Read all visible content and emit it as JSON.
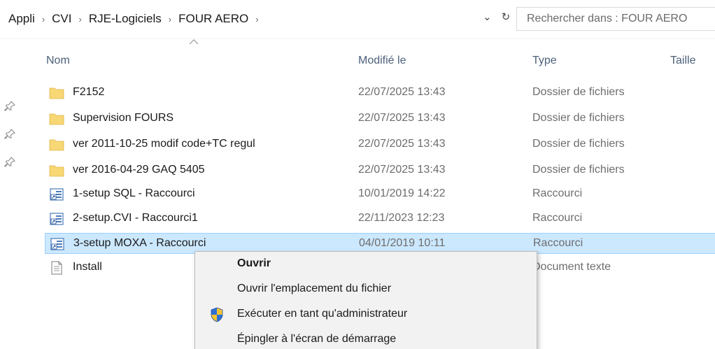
{
  "breadcrumb": [
    "Appli",
    "CVI",
    "RJE-Logiciels",
    "FOUR AERO"
  ],
  "breadcrumb_separator": "›",
  "address_controls": {
    "dropdown": "⌄",
    "refresh": "↻"
  },
  "search": {
    "placeholder": "Rechercher dans : FOUR AERO"
  },
  "columns": {
    "name": "Nom",
    "modified": "Modifié le",
    "type": "Type",
    "size": "Taille"
  },
  "files": [
    {
      "name": "F2152",
      "modified": "22/07/2025 13:43",
      "type": "Dossier de fichiers",
      "icon": "folder-icon"
    },
    {
      "name": "Supervision FOURS",
      "modified": "22/07/2025 13:43",
      "type": "Dossier de fichiers",
      "icon": "folder-icon"
    },
    {
      "name": "ver 2011-10-25 modif code+TC regul",
      "modified": "22/07/2025 13:43",
      "type": "Dossier de fichiers",
      "icon": "folder-icon"
    },
    {
      "name": "ver 2016-04-29 GAQ 5405",
      "modified": "22/07/2025 13:43",
      "type": "Dossier de fichiers",
      "icon": "folder-icon"
    },
    {
      "name": "1-setup SQL - Raccourci",
      "modified": "10/01/2019 14:22",
      "type": "Raccourci",
      "icon": "shortcut-icon"
    },
    {
      "name": "2-setup.CVI - Raccourci1",
      "modified": "22/11/2023 12:23",
      "type": "Raccourci",
      "icon": "shortcut-icon"
    },
    {
      "name": "3-setup MOXA - Raccourci",
      "modified": "04/01/2019 10:11",
      "type": "Raccourci",
      "icon": "shortcut-icon",
      "selected": true
    },
    {
      "name": "Install",
      "modified": "",
      "type": "Document texte",
      "icon": "text-document-icon"
    }
  ],
  "context_menu": [
    {
      "label": "Ouvrir",
      "bold": true
    },
    {
      "label": "Ouvrir l'emplacement du fichier"
    },
    {
      "label": "Exécuter en tant qu'administrateur",
      "icon": "uac-shield-icon"
    },
    {
      "label": "Épingler à l'écran de démarrage"
    }
  ],
  "colors": {
    "selection": "#cce8ff",
    "selection_border": "#99d1ff",
    "header_text": "#4c607a",
    "folder": "#f8d775",
    "menu_bg": "#f2f2f2"
  }
}
